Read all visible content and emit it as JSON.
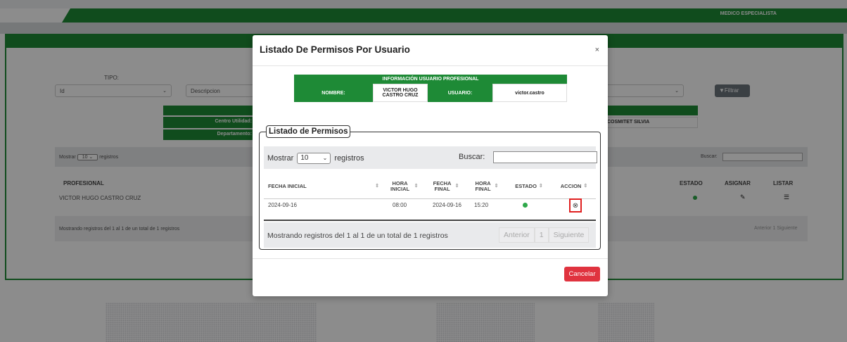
{
  "header": {
    "user_role": "MEDICO ESPECIALISTA"
  },
  "filters": {
    "tipo_label": "TIPO:",
    "tipo_value": "Id",
    "descripcion_placeholder": "Descripcion",
    "filter_button": "Filtrar"
  },
  "info_panel": {
    "centro_label": "Centro Utilidad:",
    "departamento_label": "Departamento:",
    "right_value": "COSMITET SILVIA"
  },
  "background_table": {
    "mostrar_prefix": "Mostrar",
    "mostrar_value": "10",
    "mostrar_suffix": "registros",
    "buscar_label": "Buscar:",
    "columns": [
      "PROFESIONAL",
      "ESTADO",
      "ASIGNAR",
      "LISTAR"
    ],
    "rows": [
      {
        "profesional": "VICTOR HUGO CASTRO CRUZ"
      }
    ],
    "footer": "Mostrando registros del 1 al 1 de un total de 1 registros",
    "pager": [
      "Anterior",
      "1",
      "Siguiente"
    ]
  },
  "modal": {
    "title": "Listado De Permisos Por Usuario",
    "close": "×",
    "user_info": {
      "header": "INFORMACIÓN USUARIO PROFESIONAL",
      "nombre_label": "NOMBRE:",
      "nombre_value": "VICTOR HUGO CASTRO CRUZ",
      "usuario_label": "USUARIO:",
      "usuario_value": "victor.castro"
    },
    "permisos": {
      "legend": "Listado de Permisos",
      "mostrar_prefix": "Mostrar",
      "mostrar_value": "10",
      "mostrar_suffix": "registros",
      "buscar_label": "Buscar:",
      "columns": {
        "fecha_inicial": "FECHA INICIAL",
        "hora_inicial": "HORA INICIAL",
        "fecha_final": "FECHA FINAL",
        "hora_final": "HORA FINAL",
        "estado": "ESTADO",
        "accion": "ACCION"
      },
      "rows": [
        {
          "fecha_inicial": "2024-09-16",
          "hora_inicial": "08:00",
          "fecha_final": "2024-09-16",
          "hora_final": "15:20",
          "estado_color": "#2ea84a"
        }
      ],
      "footer": "Mostrando registros del 1 al 1 de un total de 1 registros",
      "pager": {
        "prev": "Anterior",
        "page": "1",
        "next": "Siguiente"
      }
    },
    "cancel_button": "Cancelar"
  },
  "colors": {
    "brand_green": "#1e8a36",
    "danger": "#e0333f",
    "status_active": "#2ea84a"
  }
}
